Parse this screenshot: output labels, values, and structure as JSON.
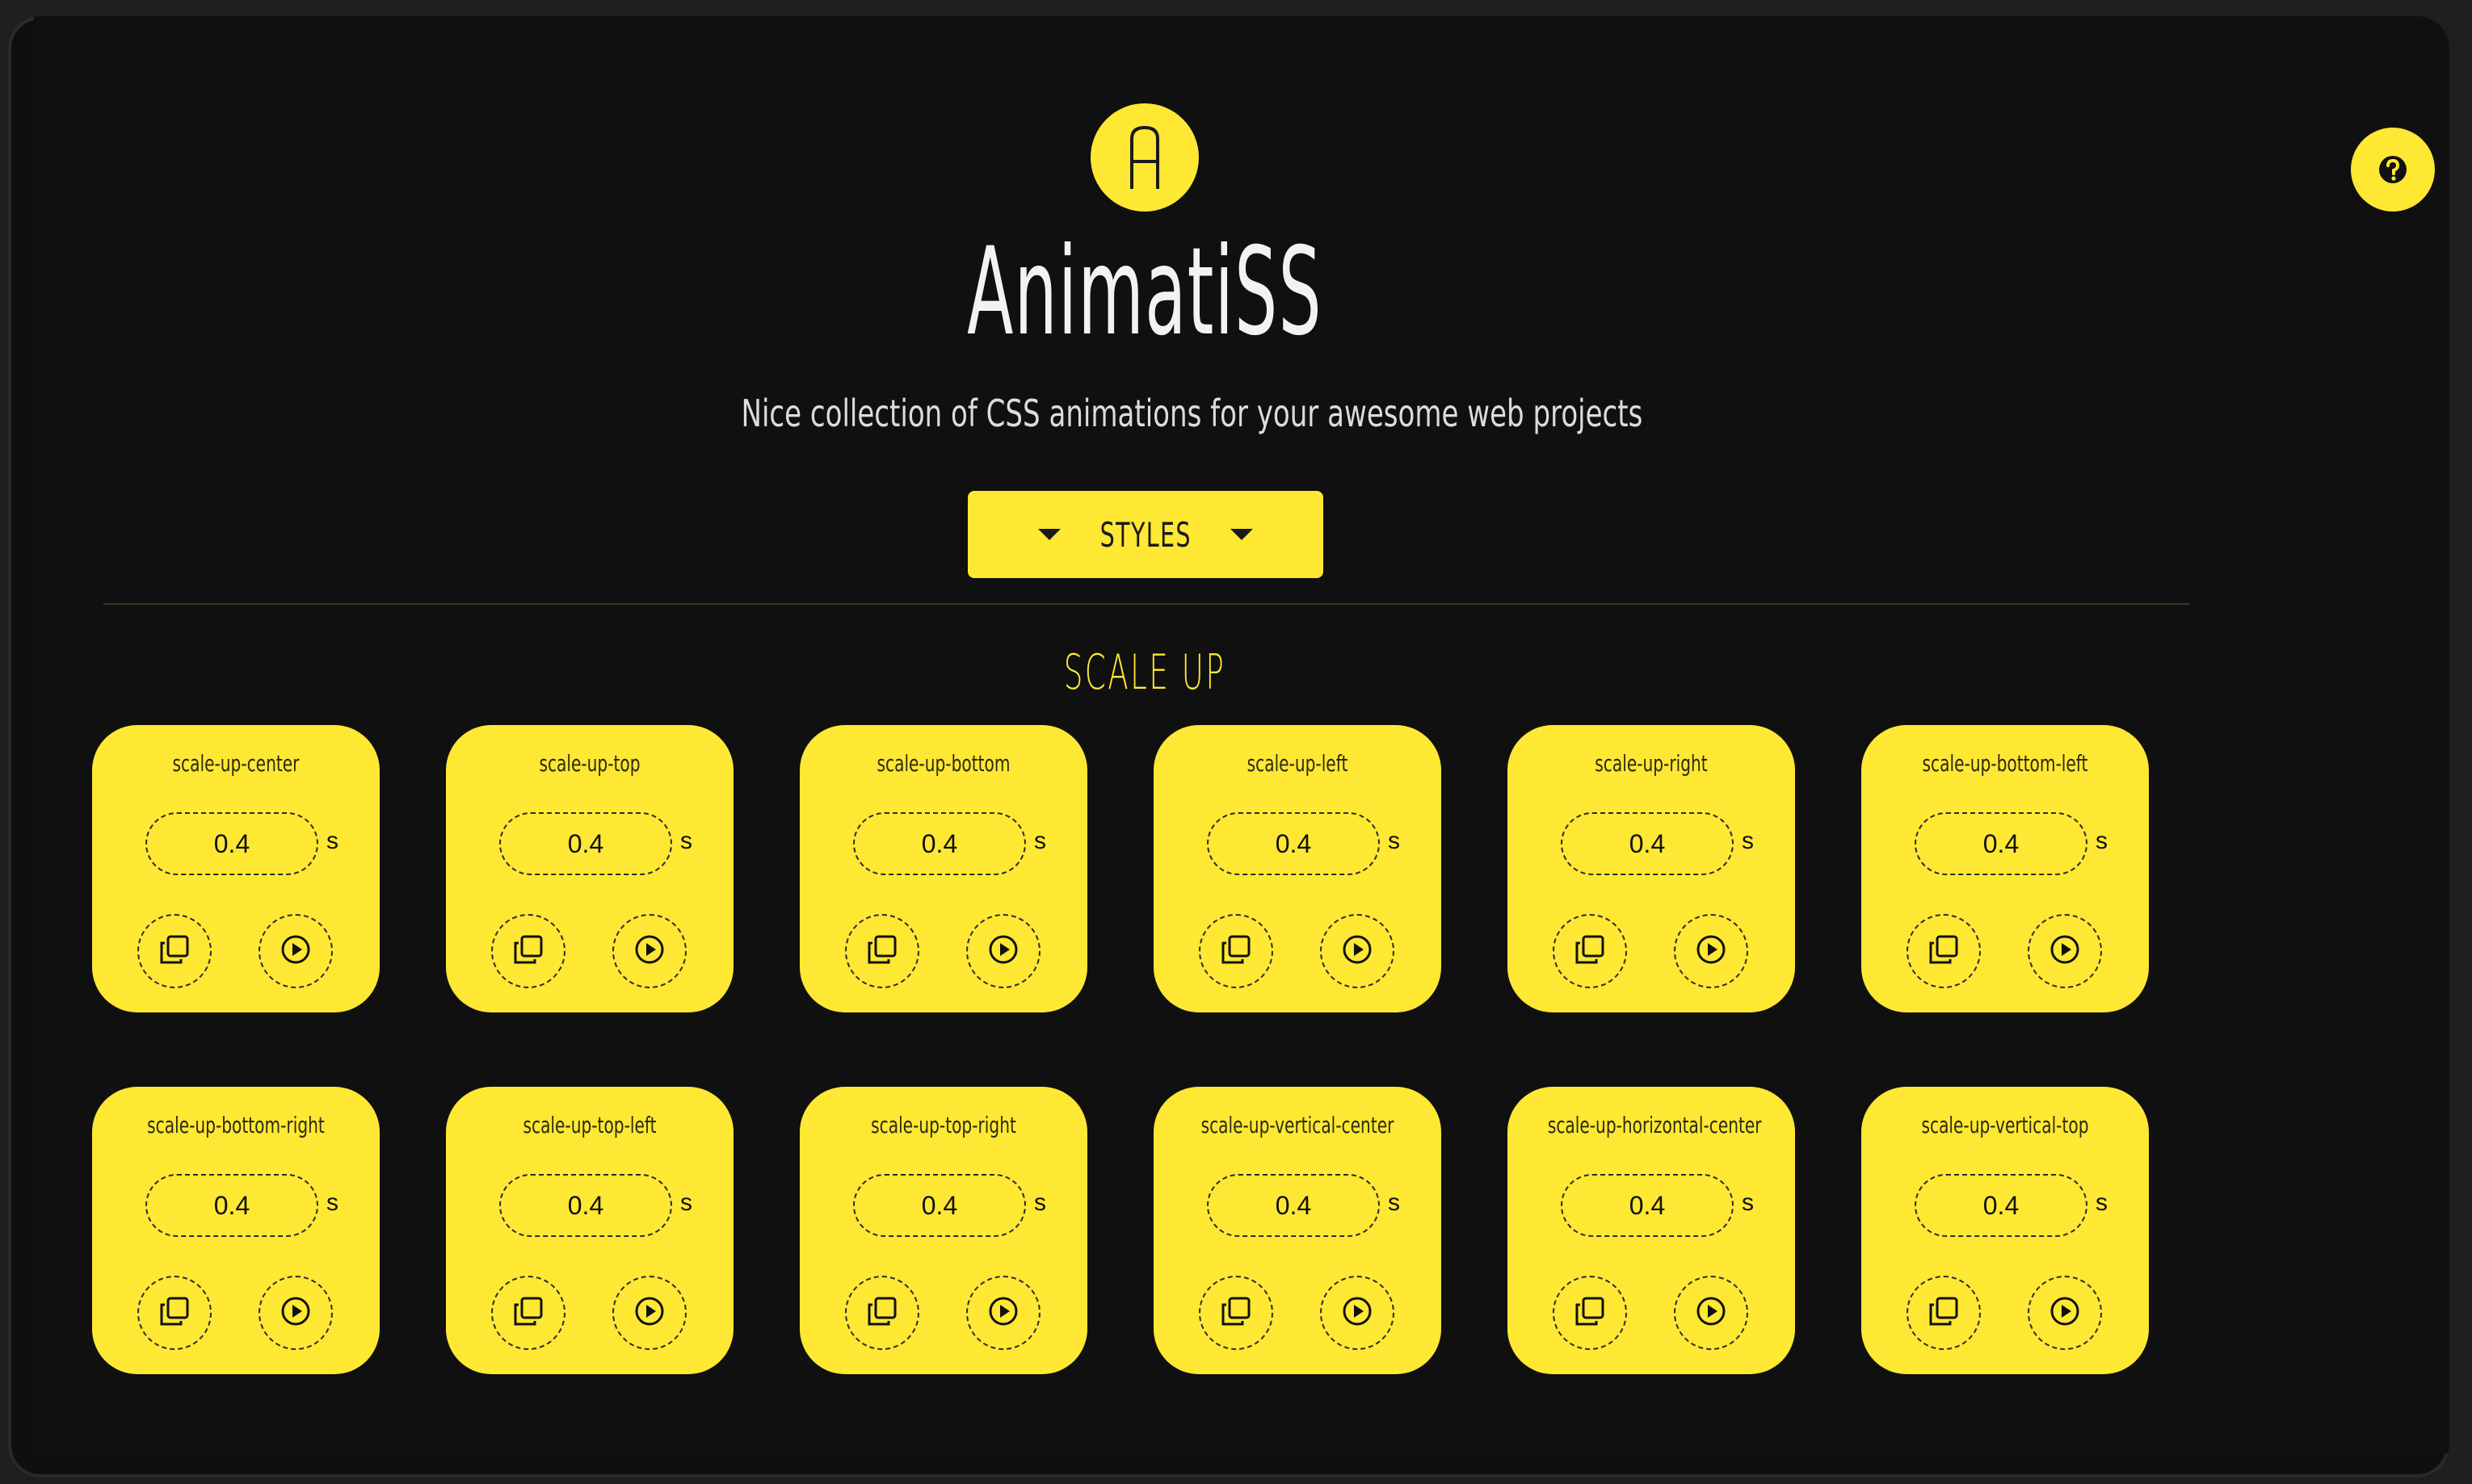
{
  "app": {
    "title": "AnimatiSS",
    "tagline": "Nice collection of CSS animations for your awesome web projects",
    "logo_letter": "A",
    "logo_icon": "logo-a-icon",
    "help_icon": "question-circle-icon",
    "accent": "#ffe833",
    "background": "#101010"
  },
  "nav": {
    "styles_label": "STYLES",
    "caret_icon": "caret-down-icon"
  },
  "section": {
    "title": "SCALE UP"
  },
  "cards": [
    {
      "name": "scale-up-center",
      "duration": "0.4",
      "unit": "s"
    },
    {
      "name": "scale-up-top",
      "duration": "0.4",
      "unit": "s"
    },
    {
      "name": "scale-up-bottom",
      "duration": "0.4",
      "unit": "s"
    },
    {
      "name": "scale-up-left",
      "duration": "0.4",
      "unit": "s"
    },
    {
      "name": "scale-up-right",
      "duration": "0.4",
      "unit": "s"
    },
    {
      "name": "scale-up-bottom-left",
      "duration": "0.4",
      "unit": "s"
    },
    {
      "name": "scale-up-bottom-right",
      "duration": "0.4",
      "unit": "s"
    },
    {
      "name": "scale-up-top-left",
      "duration": "0.4",
      "unit": "s"
    },
    {
      "name": "scale-up-top-right",
      "duration": "0.4",
      "unit": "s"
    },
    {
      "name": "scale-up-vertical-center",
      "duration": "0.4",
      "unit": "s"
    },
    {
      "name": "scale-up-horizontal-center",
      "duration": "0.4",
      "unit": "s"
    },
    {
      "name": "scale-up-vertical-top",
      "duration": "0.4",
      "unit": "s"
    }
  ],
  "card_icons": {
    "copy": "copy-icon",
    "play": "play-circle-icon"
  }
}
